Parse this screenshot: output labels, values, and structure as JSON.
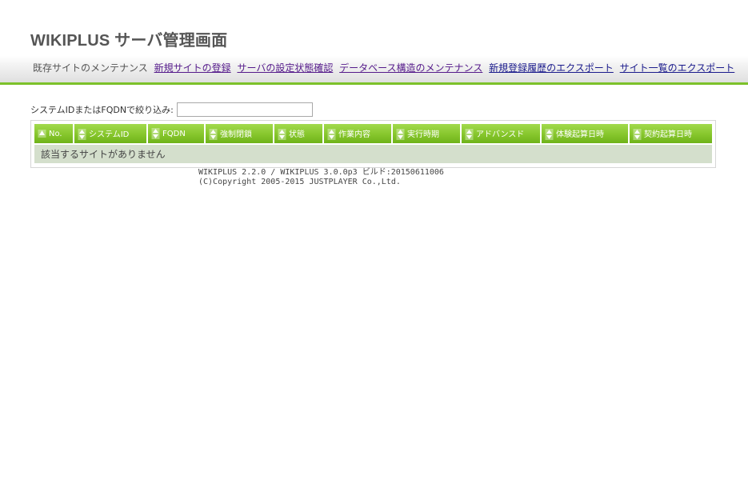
{
  "header": {
    "title": "WIKIPLUS サーバ管理画面"
  },
  "nav": {
    "current": "既存サイトのメンテナンス",
    "links": [
      {
        "label": "新規サイトの登録"
      },
      {
        "label": "サーバの設定状態確認"
      },
      {
        "label": "データベース構造のメンテナンス"
      },
      {
        "label": "新規登録履歴のエクスポート"
      },
      {
        "label": "サイト一覧のエクスポート"
      }
    ]
  },
  "filter": {
    "label": "システムIDまたはFQDNで絞り込み:",
    "value": "",
    "placeholder": ""
  },
  "table": {
    "columns": [
      "No.",
      "システムID",
      "FQDN",
      "強制閉鎖",
      "状態",
      "作業内容",
      "実行時期",
      "アドバンスド",
      "体験起算日時",
      "契約起算日時"
    ],
    "empty_message": "該当するサイトがありません"
  },
  "footer": {
    "version": "WIKIPLUS 2.2.0 / WIKIPLUS 3.0.0p3 ビルド:20150611006",
    "copyright": "(C)Copyright 2005-2015 JUSTPLAYER Co.,Ltd."
  },
  "colors": {
    "accent": "#7cc12a",
    "header_cell": "#86c62c",
    "empty_row": "#d4dfcc",
    "link": "#1a1a8c"
  }
}
